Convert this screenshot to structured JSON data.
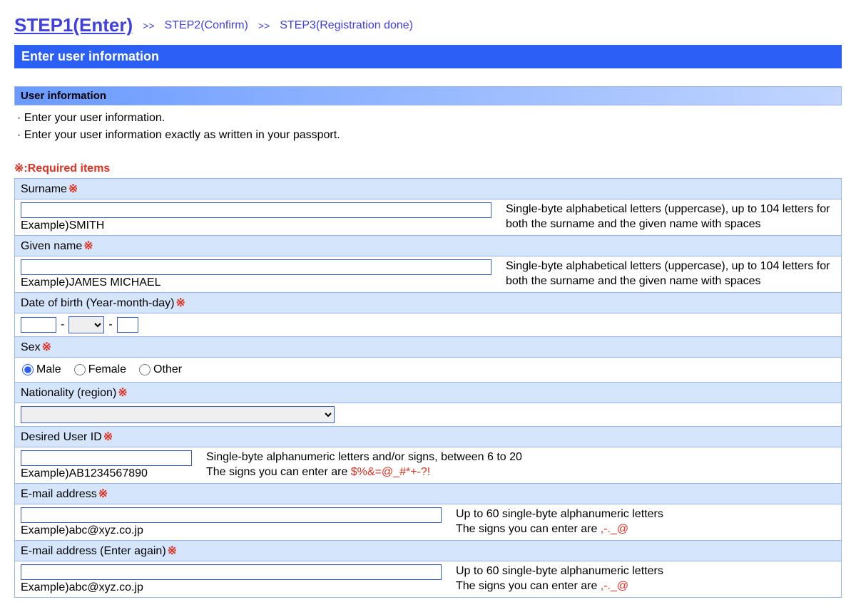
{
  "steps": {
    "current": "STEP1(Enter)",
    "sep": ">>",
    "s2": "STEP2(Confirm)",
    "s3": "STEP3(Registration done)"
  },
  "titleBar": "Enter user information",
  "section": "User information",
  "instructions": {
    "l1": "· Enter your user information.",
    "l2": "· Enter your user information exactly as written in your passport."
  },
  "reqNote": "※:Required items",
  "reqMark": "※",
  "fields": {
    "surname": {
      "label": "Surname",
      "example": "Example)SMITH",
      "helper": "Single-byte alphabetical letters (uppercase), up to 104 letters for both the surname and the given name with spaces"
    },
    "given": {
      "label": "Given name",
      "example": "Example)JAMES MICHAEL",
      "helper": "Single-byte alphabetical letters (uppercase), up to 104 letters for both the surname and the given name with spaces"
    },
    "dob": {
      "label": "Date of birth (Year-month-day)",
      "dash": "-"
    },
    "sex": {
      "label": "Sex",
      "male": "Male",
      "female": "Female",
      "other": "Other"
    },
    "nat": {
      "label": "Nationality (region)"
    },
    "userid": {
      "label": "Desired User ID",
      "example": "Example)AB1234567890",
      "helper1": "Single-byte alphanumeric letters and/or signs, between 6 to 20",
      "helper2a": "The signs you can enter are ",
      "helper2b": "$%&=@_#*+-?!"
    },
    "email": {
      "label": "E-mail address",
      "example": "Example)abc@xyz.co.jp",
      "helper1": "Up to 60 single-byte alphanumeric letters",
      "helper2a": "The signs you can enter are ",
      "helper2b": ",-._@"
    },
    "email2": {
      "label": "E-mail address (Enter again)",
      "example": "Example)abc@xyz.co.jp",
      "helper1": "Up to 60 single-byte alphanumeric letters",
      "helper2a": "The signs you can enter are ",
      "helper2b": ",-._@"
    }
  }
}
